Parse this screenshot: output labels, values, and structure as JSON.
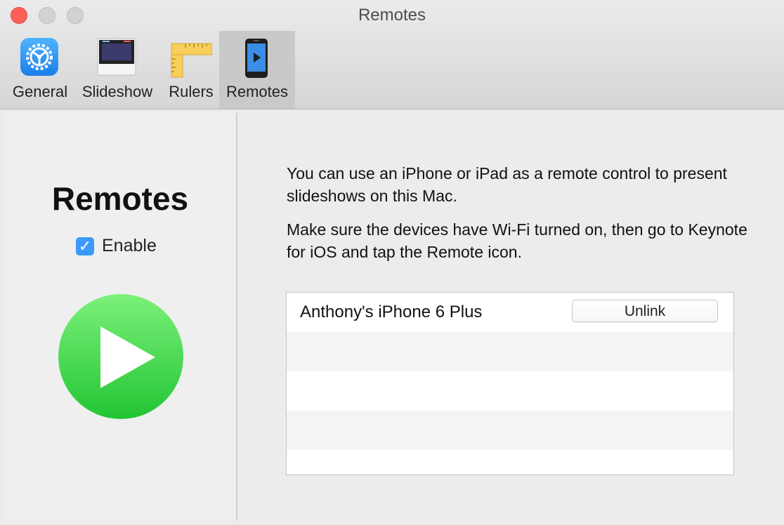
{
  "window": {
    "title": "Remotes"
  },
  "toolbar": {
    "tabs": [
      {
        "label": "General",
        "icon": "gear-icon"
      },
      {
        "label": "Slideshow",
        "icon": "slideshow-icon"
      },
      {
        "label": "Rulers",
        "icon": "ruler-icon"
      },
      {
        "label": "Remotes",
        "icon": "iphone-remote-icon",
        "selected": true
      }
    ]
  },
  "left_panel": {
    "heading": "Remotes",
    "enable_label": "Enable",
    "enable_checked": true,
    "play_icon": "play-icon"
  },
  "main": {
    "description_1": "You can use an iPhone or iPad as a remote control to present slideshows on this Mac.",
    "description_2": "Make sure the devices have Wi-Fi turned on, then go to Keynote for iOS and tap the Remote icon.",
    "devices": [
      {
        "name": "Anthony's iPhone 6 Plus",
        "action": "Unlink"
      }
    ]
  },
  "colors": {
    "accent": "#3b99fc",
    "play_green": "#33cc44",
    "close_red": "#fc5f57"
  }
}
